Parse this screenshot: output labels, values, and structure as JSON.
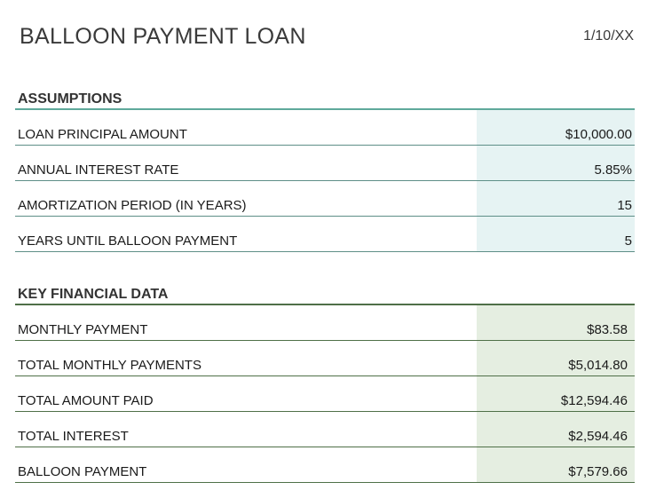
{
  "header": {
    "title": "BALLOON PAYMENT LOAN",
    "date": "1/10/XX"
  },
  "assumptions": {
    "heading": "ASSUMPTIONS",
    "rows": [
      {
        "label": "LOAN PRINCIPAL AMOUNT",
        "value": "$10,000.00"
      },
      {
        "label": "ANNUAL INTEREST RATE",
        "value": "5.85%"
      },
      {
        "label": "AMORTIZATION PERIOD (IN YEARS)",
        "value": "15"
      },
      {
        "label": "YEARS UNTIL BALLOON PAYMENT",
        "value": "5"
      }
    ]
  },
  "key_financial_data": {
    "heading": "KEY FINANCIAL DATA",
    "rows": [
      {
        "label": "MONTHLY PAYMENT",
        "value": "$83.58"
      },
      {
        "label": "TOTAL MONTHLY PAYMENTS",
        "value": "$5,014.80"
      },
      {
        "label": "TOTAL AMOUNT PAID",
        "value": "$12,594.46"
      },
      {
        "label": "TOTAL INTEREST",
        "value": "$2,594.46"
      },
      {
        "label": "BALLOON PAYMENT",
        "value": "$7,579.66"
      }
    ]
  },
  "colors": {
    "assumptions_accent": "#5fa99b",
    "assumptions_shade": "#e6f3f3",
    "keydata_accent": "#4f7048",
    "keydata_shade": "#e5eee1"
  }
}
